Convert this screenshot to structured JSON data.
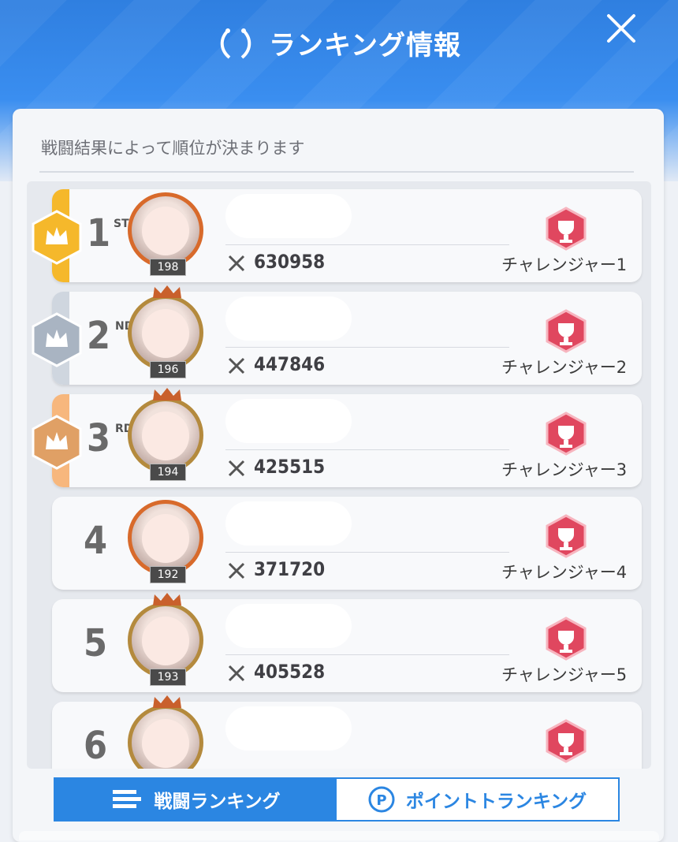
{
  "header": {
    "title": "ランキング情報"
  },
  "panel": {
    "subtitle": "戦闘結果によって順位が決まります"
  },
  "rows": [
    {
      "rank": "1",
      "suffix": "ST",
      "level": "198",
      "score": "630958",
      "tier": "チャレンジャー1"
    },
    {
      "rank": "2",
      "suffix": "ND",
      "level": "196",
      "score": "447846",
      "tier": "チャレンジャー2"
    },
    {
      "rank": "3",
      "suffix": "RD",
      "level": "194",
      "score": "425515",
      "tier": "チャレンジャー3"
    },
    {
      "rank": "4",
      "suffix": "",
      "level": "192",
      "score": "371720",
      "tier": "チャレンジャー4"
    },
    {
      "rank": "5",
      "suffix": "",
      "level": "193",
      "score": "405528",
      "tier": "チャレンジャー5"
    },
    {
      "rank": "6",
      "suffix": "",
      "level": "",
      "score": "",
      "tier": ""
    }
  ],
  "tabs": {
    "battle": "戦闘ランキング",
    "points": "ポイントトランキング"
  },
  "colors": {
    "accent": "#2b86e2",
    "gold": "#f5b82b",
    "silver": "#a9b4c2",
    "bronze": "#e0a065",
    "trophy": "#e0475f"
  },
  "icons": [
    "laurel-icon",
    "close-icon",
    "swords-icon",
    "trophy-icon",
    "point-p-icon",
    "bars-icon"
  ]
}
